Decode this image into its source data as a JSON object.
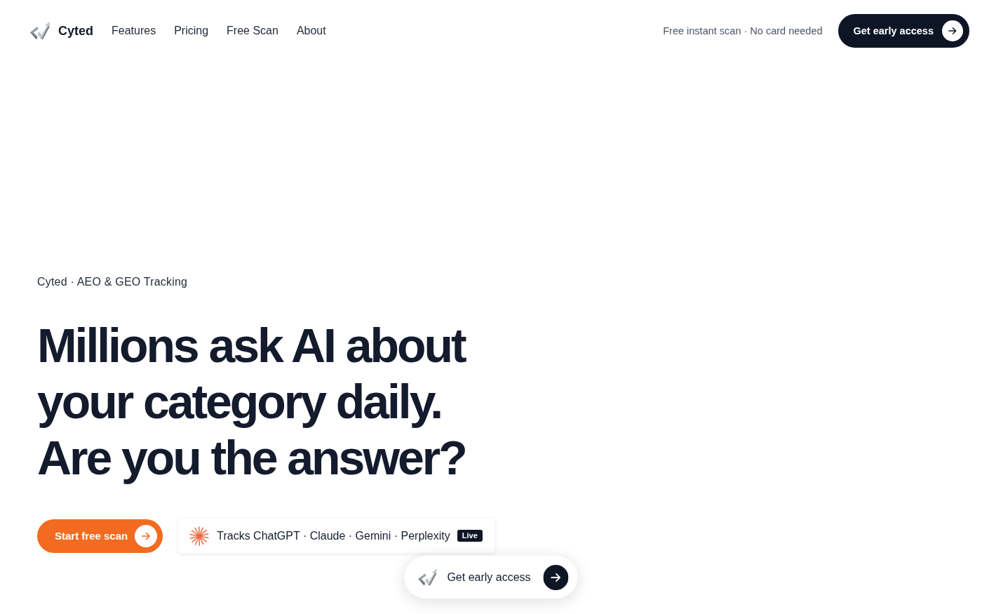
{
  "nav": {
    "brand": "Cyted",
    "links": [
      "Features",
      "Pricing",
      "Free Scan",
      "About"
    ],
    "note": "Free instant scan · No card needed",
    "cta": "Get early access"
  },
  "hero": {
    "eyebrow": "Cyted · AEO & GEO Tracking",
    "headline": [
      "Millions ask AI about",
      "your category daily.",
      "Are you the answer?"
    ],
    "primary_button": "Start free scan",
    "tracks": {
      "text": "Tracks ChatGPT · Claude · Gemini · Perplexity",
      "badge": "Live"
    }
  },
  "floating_bar": {
    "label": "Get early access"
  }
}
